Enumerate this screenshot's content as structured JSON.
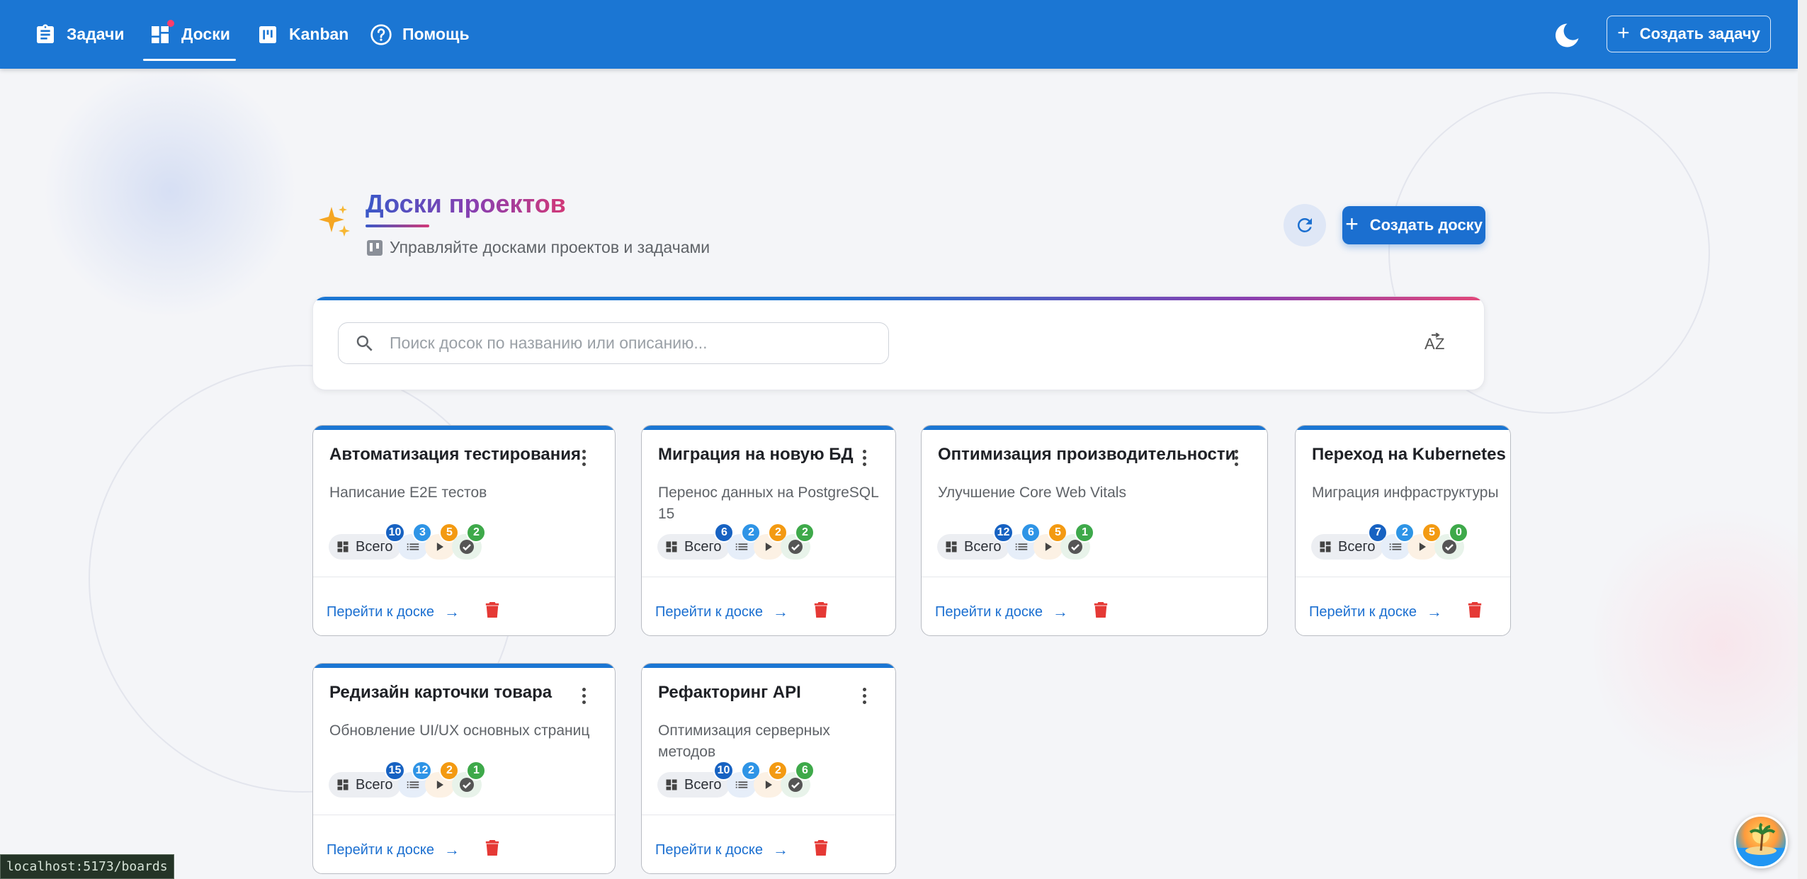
{
  "nav": {
    "items": [
      {
        "label": "Задачи",
        "icon": "clipboard-icon"
      },
      {
        "label": "Доски",
        "icon": "dashboard-icon",
        "active": true
      },
      {
        "label": "Kanban",
        "icon": "kanban-icon"
      },
      {
        "label": "Помощь",
        "icon": "help-icon"
      }
    ],
    "theme_icon": "moon-icon",
    "create_task_label": "Создать задачу"
  },
  "header": {
    "title": "Доски проектов",
    "subtitle": "Управляйте досками проектов и задачами",
    "create_board_label": "Создать доску"
  },
  "search": {
    "placeholder": "Поиск досок по названию или описанию...",
    "value": "",
    "sort_icon": "sort-az-icon"
  },
  "boards": [
    {
      "title": "Автоматизация тестирования",
      "description": "Написание E2E тестов",
      "total_label": "Всего",
      "total": "10",
      "todo": "3",
      "in_progress": "5",
      "done": "2",
      "goto_label": "Перейти к доске"
    },
    {
      "title": "Миграция на новую БД",
      "description": "Перенос данных на PostgreSQL 15",
      "total_label": "Всего",
      "total": "6",
      "todo": "2",
      "in_progress": "2",
      "done": "2",
      "goto_label": "Перейти к доске"
    },
    {
      "title": "Оптимизация производительности",
      "description": "Улучшение Core Web Vitals",
      "total_label": "Всего",
      "total": "12",
      "todo": "6",
      "in_progress": "5",
      "done": "1",
      "goto_label": "Перейти к доске"
    },
    {
      "title": "Переход на Kubernetes",
      "description": "Миграция инфраструктуры",
      "total_label": "Всего",
      "total": "7",
      "todo": "2",
      "in_progress": "5",
      "done": "0",
      "goto_label": "Перейти к доске"
    },
    {
      "title": "Редизайн карточки товара",
      "description": "Обновление UI/UX основных страниц",
      "total_label": "Всего",
      "total": "15",
      "todo": "12",
      "in_progress": "2",
      "done": "1",
      "goto_label": "Перейти к доске"
    },
    {
      "title": "Рефакторинг API",
      "description": "Оптимизация серверных методов",
      "total_label": "Всего",
      "total": "10",
      "todo": "2",
      "in_progress": "2",
      "done": "6",
      "goto_label": "Перейти к доске"
    }
  ],
  "status_bar": {
    "url": "localhost:5173/boards"
  },
  "colors": {
    "appbar": "#1b76d3",
    "accent": "#1b6fd0",
    "badge_total": "#1762c2",
    "badge_todo": "#2e94e6",
    "badge_in_progress": "#f39a12",
    "badge_done": "#3ea94a",
    "delete": "#e53935"
  }
}
